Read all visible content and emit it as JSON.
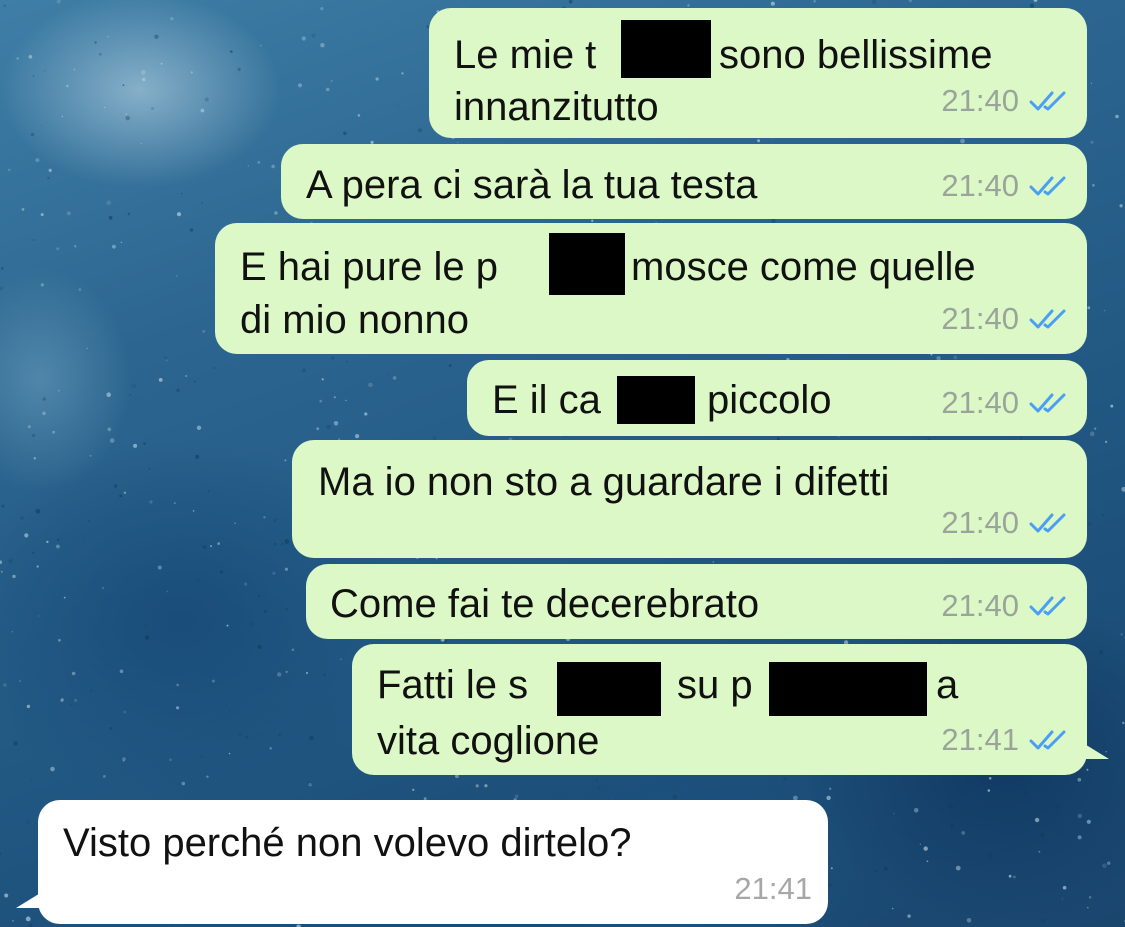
{
  "messages": [
    {
      "direction": "outgoing",
      "lines": [
        "Le mie t",
        "sono bellissime",
        "innanzitutto"
      ],
      "time": "21:40",
      "status": "read-double-check-icon"
    },
    {
      "direction": "outgoing",
      "lines": [
        "A pera ci sarà la tua testa"
      ],
      "time": "21:40",
      "status": "read-double-check-icon"
    },
    {
      "direction": "outgoing",
      "lines": [
        "E hai pure le p",
        "mosce come quelle",
        "di mio nonno"
      ],
      "time": "21:40",
      "status": "read-double-check-icon"
    },
    {
      "direction": "outgoing",
      "lines": [
        "E il ca",
        "piccolo"
      ],
      "time": "21:40",
      "status": "read-double-check-icon"
    },
    {
      "direction": "outgoing",
      "lines": [
        "Ma io non sto a guardare i difetti"
      ],
      "time": "21:40",
      "status": "read-double-check-icon"
    },
    {
      "direction": "outgoing",
      "lines": [
        "Come fai te decerebrato"
      ],
      "time": "21:40",
      "status": "read-double-check-icon"
    },
    {
      "direction": "outgoing",
      "lines": [
        "Fatti le s",
        "su p",
        "a",
        "vita coglione"
      ],
      "time": "21:41",
      "status": "read-double-check-icon"
    },
    {
      "direction": "incoming",
      "lines": [
        "Visto perché non volevo dirtelo?"
      ],
      "time": "21:41"
    }
  ],
  "colors": {
    "outgoing_bubble": "#dcf8c6",
    "incoming_bubble": "#ffffff",
    "read_ticks": "#4a9ff5",
    "timestamp": "#9aa49a",
    "redaction": "#000000"
  }
}
